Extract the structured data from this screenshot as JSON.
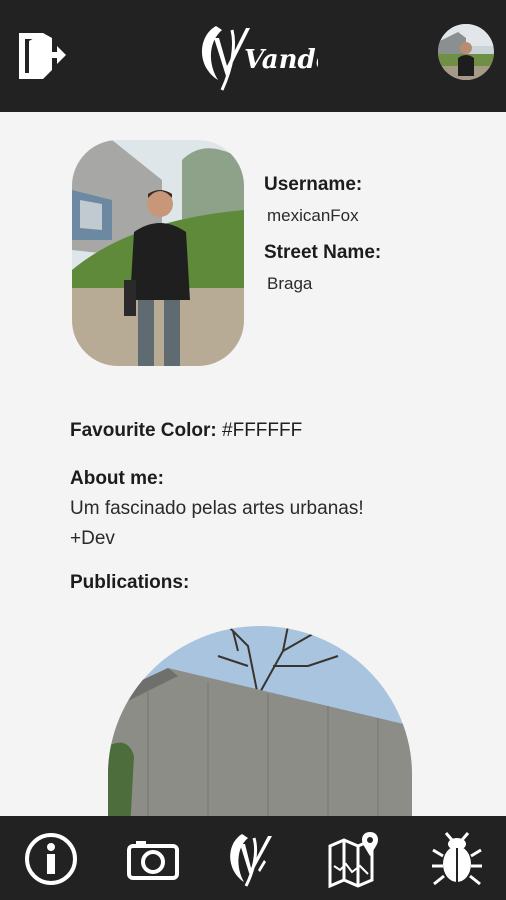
{
  "header": {
    "logo_text": "Vander",
    "logout_icon": "logout-icon",
    "avatar_icon": "avatar"
  },
  "profile": {
    "username_label": "Username:",
    "username_value": "mexicanFox",
    "street_label": "Street Name:",
    "street_value": "Braga",
    "favourite_color_label": "Favourite Color:",
    "favourite_color_value": "#FFFFFF",
    "about_label": "About me:",
    "about_line1": "Um fascinado pelas artes urbanas!",
    "about_line2": "+Dev",
    "publications_label": "Publications:"
  },
  "bottom_nav": {
    "items": [
      {
        "icon": "info-icon"
      },
      {
        "icon": "camera-icon"
      },
      {
        "icon": "vander-logo-icon"
      },
      {
        "icon": "map-icon"
      },
      {
        "icon": "bug-icon"
      }
    ]
  },
  "colors": {
    "bar_bg": "#222222",
    "page_bg": "#f4f4f4",
    "icon_white": "#ffffff"
  }
}
